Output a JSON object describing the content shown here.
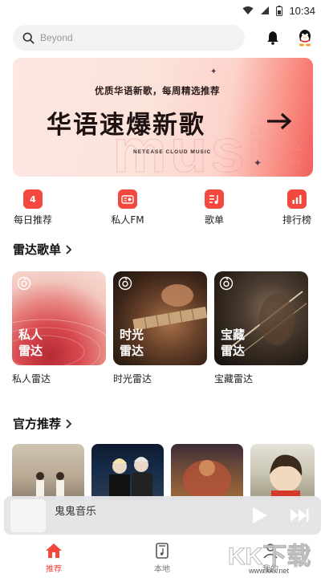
{
  "status_bar": {
    "time": "10:34"
  },
  "search": {
    "placeholder": "Beyond"
  },
  "banner": {
    "subtitle": "优质华语新歌，每周精选推荐",
    "title": "华语速爆新歌",
    "brand": "NETEASE CLOUD MUSIC",
    "watermark": "music"
  },
  "quick_actions": [
    {
      "label": "每日推荐",
      "icon": "calendar-icon",
      "date": "4"
    },
    {
      "label": "私人FM",
      "icon": "radio-icon"
    },
    {
      "label": "歌单",
      "icon": "playlist-icon"
    },
    {
      "label": "排行榜",
      "icon": "chart-icon"
    }
  ],
  "radar": {
    "title": "雷达歌单",
    "cards": [
      {
        "cover_label": "私人雷达",
        "name": "私人雷达"
      },
      {
        "cover_label": "时光雷达",
        "name": "时光雷达"
      },
      {
        "cover_label": "宝藏雷达",
        "name": "宝藏雷达"
      }
    ]
  },
  "official": {
    "title": "官方推荐"
  },
  "player": {
    "song": "鬼鬼音乐"
  },
  "tabs": [
    {
      "label": "推荐",
      "active": true
    },
    {
      "label": "本地",
      "active": false
    },
    {
      "label": "我的",
      "active": false
    }
  ],
  "watermark": {
    "text": "KK下载",
    "url": "www.kkx.net"
  },
  "colors": {
    "accent": "#f2483e",
    "search_bg": "#f1f2f4"
  }
}
